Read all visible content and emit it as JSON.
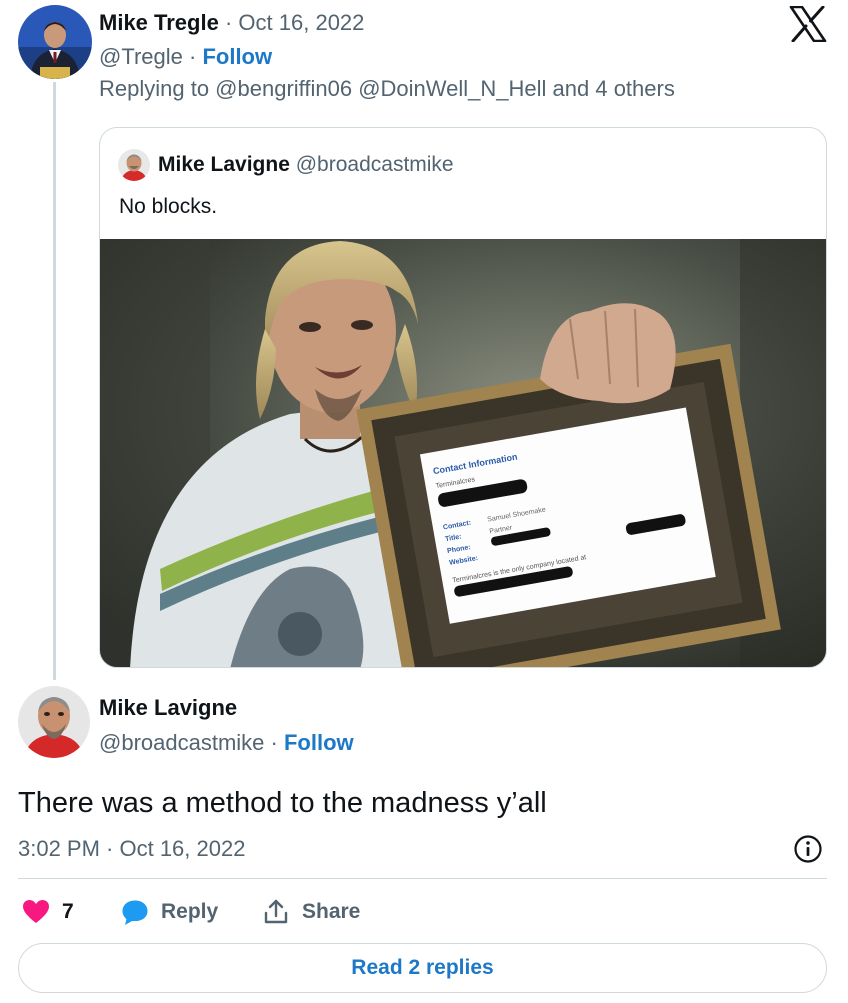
{
  "parent_tweet": {
    "author_name": "Mike Tregle",
    "separator": "·",
    "date": "Oct 16, 2022",
    "handle": "@Tregle",
    "follow_label": "Follow",
    "replying_to": "Replying to @bengriffin06 @DoinWell_N_Hell and 4 others",
    "avatar_icon": "person-at-podium-avatar",
    "quoted": {
      "author_name": "Mike Lavigne",
      "handle": "@broadcastmike",
      "text": "No blocks.",
      "media": {
        "frame_title": "Contact Information",
        "frame_company": "Terminalcres",
        "rows": [
          {
            "label": "Contact:",
            "value": "Samuel Shoemake"
          },
          {
            "label": "Title:",
            "value": "Partner"
          },
          {
            "label": "Phone:",
            "value": ""
          },
          {
            "label": "Website:",
            "value": ""
          }
        ],
        "footer_text": "Terminalcres is the only company located at"
      }
    }
  },
  "main_tweet": {
    "author_name": "Mike Lavigne",
    "handle": "@broadcastmike",
    "separator": "·",
    "follow_label": "Follow",
    "text": "There was a method to the madness y’all",
    "timestamp": "3:02 PM · Oct 16, 2022"
  },
  "actions": {
    "like_count": "7",
    "reply_label": "Reply",
    "share_label": "Share",
    "read_replies_label": "Read 2 replies"
  },
  "colors": {
    "accent": "#1d78c7",
    "like": "#f91880",
    "muted": "#536471",
    "border": "#cfd9de"
  }
}
